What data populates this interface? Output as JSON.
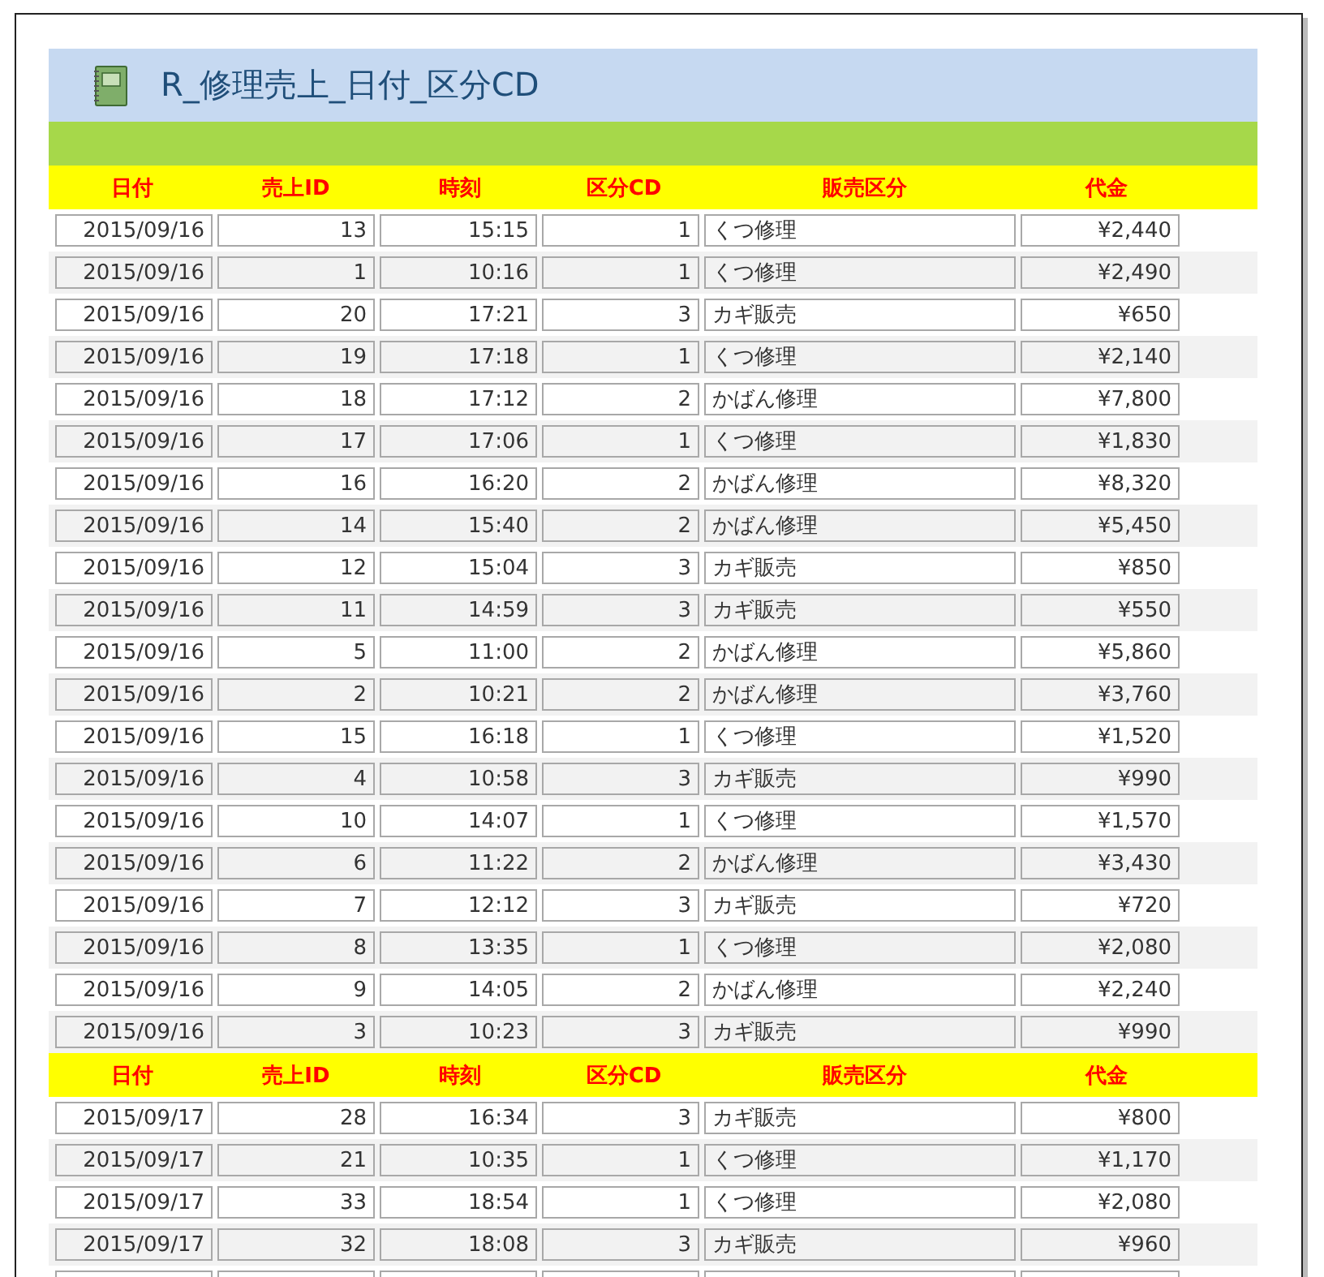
{
  "report": {
    "title": "R_修理売上_日付_区分CD"
  },
  "groups": [
    {
      "columns": [
        "日付",
        "売上ID",
        "時刻",
        "区分CD",
        "販売区分",
        "代金"
      ],
      "rows": [
        [
          "2015/09/16",
          "13",
          "15:15",
          "1",
          "くつ修理",
          "¥2,440"
        ],
        [
          "2015/09/16",
          "1",
          "10:16",
          "1",
          "くつ修理",
          "¥2,490"
        ],
        [
          "2015/09/16",
          "20",
          "17:21",
          "3",
          "カギ販売",
          "¥650"
        ],
        [
          "2015/09/16",
          "19",
          "17:18",
          "1",
          "くつ修理",
          "¥2,140"
        ],
        [
          "2015/09/16",
          "18",
          "17:12",
          "2",
          "かばん修理",
          "¥7,800"
        ],
        [
          "2015/09/16",
          "17",
          "17:06",
          "1",
          "くつ修理",
          "¥1,830"
        ],
        [
          "2015/09/16",
          "16",
          "16:20",
          "2",
          "かばん修理",
          "¥8,320"
        ],
        [
          "2015/09/16",
          "14",
          "15:40",
          "2",
          "かばん修理",
          "¥5,450"
        ],
        [
          "2015/09/16",
          "12",
          "15:04",
          "3",
          "カギ販売",
          "¥850"
        ],
        [
          "2015/09/16",
          "11",
          "14:59",
          "3",
          "カギ販売",
          "¥550"
        ],
        [
          "2015/09/16",
          "5",
          "11:00",
          "2",
          "かばん修理",
          "¥5,860"
        ],
        [
          "2015/09/16",
          "2",
          "10:21",
          "2",
          "かばん修理",
          "¥3,760"
        ],
        [
          "2015/09/16",
          "15",
          "16:18",
          "1",
          "くつ修理",
          "¥1,520"
        ],
        [
          "2015/09/16",
          "4",
          "10:58",
          "3",
          "カギ販売",
          "¥990"
        ],
        [
          "2015/09/16",
          "10",
          "14:07",
          "1",
          "くつ修理",
          "¥1,570"
        ],
        [
          "2015/09/16",
          "6",
          "11:22",
          "2",
          "かばん修理",
          "¥3,430"
        ],
        [
          "2015/09/16",
          "7",
          "12:12",
          "3",
          "カギ販売",
          "¥720"
        ],
        [
          "2015/09/16",
          "8",
          "13:35",
          "1",
          "くつ修理",
          "¥2,080"
        ],
        [
          "2015/09/16",
          "9",
          "14:05",
          "2",
          "かばん修理",
          "¥2,240"
        ],
        [
          "2015/09/16",
          "3",
          "10:23",
          "3",
          "カギ販売",
          "¥990"
        ]
      ]
    },
    {
      "columns": [
        "日付",
        "売上ID",
        "時刻",
        "区分CD",
        "販売区分",
        "代金"
      ],
      "rows": [
        [
          "2015/09/17",
          "28",
          "16:34",
          "3",
          "カギ販売",
          "¥800"
        ],
        [
          "2015/09/17",
          "21",
          "10:35",
          "1",
          "くつ修理",
          "¥1,170"
        ],
        [
          "2015/09/17",
          "33",
          "18:54",
          "1",
          "くつ修理",
          "¥2,080"
        ],
        [
          "2015/09/17",
          "32",
          "18:08",
          "3",
          "カギ販売",
          "¥960"
        ]
      ]
    }
  ]
}
